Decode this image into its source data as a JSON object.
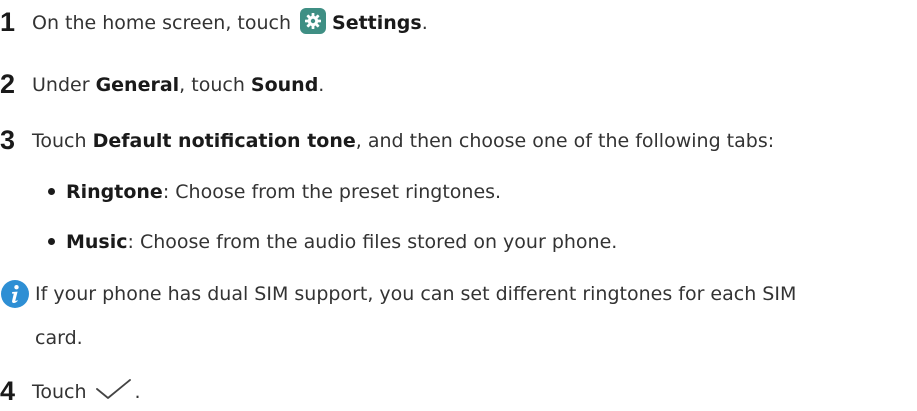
{
  "steps": [
    {
      "number": "1",
      "pre": "On the home screen, touch",
      "bold": "Settings",
      "post": "."
    },
    {
      "number": "2",
      "pre": "Under ",
      "bold1": "General",
      "mid": ", touch ",
      "bold2": "Sound",
      "post": "."
    },
    {
      "number": "3",
      "pre": "Touch ",
      "bold": "Default notification tone",
      "post": ", and then choose one of the following tabs:"
    },
    {
      "number": "4",
      "pre": "Touch",
      "post": "."
    }
  ],
  "bullets": [
    {
      "bold": "Ringtone",
      "text": ": Choose from the preset ringtones."
    },
    {
      "bold": "Music",
      "text": ": Choose from the audio files stored on your phone."
    }
  ],
  "note": {
    "line1": "If your phone has dual SIM support, you can set different ringtones for each SIM",
    "line2": "card."
  },
  "icons": {
    "settings": "settings-gear-icon",
    "info": "info-icon",
    "confirm": "checkmark-icon",
    "settings_color": "#3f8f84",
    "info_color": "#2e8fd4"
  }
}
